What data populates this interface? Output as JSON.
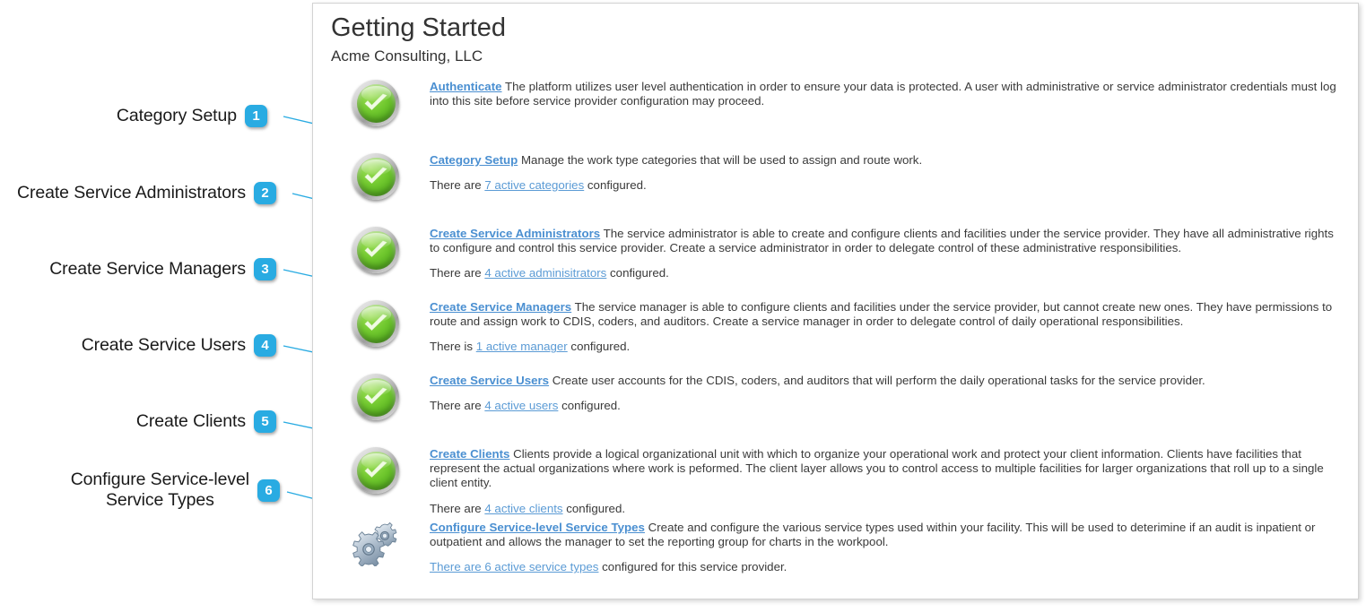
{
  "annotations": [
    {
      "number": "1",
      "label": "Category Setup",
      "multiline": false
    },
    {
      "number": "2",
      "label": "Create Service Administrators",
      "multiline": false
    },
    {
      "number": "3",
      "label": "Create Service Managers",
      "multiline": false
    },
    {
      "number": "4",
      "label": "Create Service Users",
      "multiline": false
    },
    {
      "number": "5",
      "label": "Create Clients",
      "multiline": false
    },
    {
      "number": "6",
      "label": "Configure Service-level\nService Types",
      "multiline": true
    }
  ],
  "panel": {
    "title": "Getting Started",
    "subtitle": "Acme Consulting, LLC",
    "steps": [
      {
        "icon": "green-check-icon",
        "link_label": "Authenticate",
        "description": " The platform utilizes user level authentication in order to ensure your data is protected. A user with administrative or service administrator credentials must log into this site before service provider configuration may proceed.",
        "count_prefix": "",
        "count_link": "",
        "count_suffix": ""
      },
      {
        "icon": "green-check-icon",
        "link_label": "Category Setup",
        "description": " Manage the work type categories that will be used to assign and route work.",
        "count_prefix": "There are ",
        "count_link": "7 active categories",
        "count_suffix": " configured."
      },
      {
        "icon": "green-check-icon",
        "link_label": "Create Service Administrators",
        "description": " The service administrator is able to create and configure clients and facilities under the service provider. They have all administrative rights to configure and control this service provider. Create a service administrator in order to delegate control of these administrative responsibilities.",
        "count_prefix": "There are ",
        "count_link": "4 active adminisitrators",
        "count_suffix": " configured."
      },
      {
        "icon": "green-check-icon",
        "link_label": "Create Service Managers",
        "description": " The service manager is able to configure clients and facilities under the service provider, but cannot create new ones. They have permissions to route and assign work to CDIS, coders, and auditors. Create a service manager in order to delegate control of daily operational responsibilities.",
        "count_prefix": "There is ",
        "count_link": "1 active manager",
        "count_suffix": " configured."
      },
      {
        "icon": "green-check-icon",
        "link_label": "Create Service Users",
        "description": " Create user accounts for the CDIS, coders, and auditors that will perform the daily operational tasks for the service provider.",
        "count_prefix": "There are ",
        "count_link": "4 active users",
        "count_suffix": " configured."
      },
      {
        "icon": "green-check-icon",
        "link_label": "Create Clients",
        "description": " Clients provide a logical organizational unit with which to organize your operational work and protect your client information. Clients have facilities that represent the actual organizations where work is peformed. The client layer allows you to control access to multiple facilities for larger organizations that roll up to a single client entity.",
        "count_prefix": "There are ",
        "count_link": "4 active clients",
        "count_suffix": " configured."
      },
      {
        "icon": "gears-icon",
        "link_label": "Configure Service-level Service Types",
        "description": " Create and configure the various service types used within your facility. This will be used to deterimine if an audit is inpatient or outpatient and allows the manager to set the reporting group for charts in the workpool.",
        "count_prefix": "",
        "count_link": "There are 6 active service types",
        "count_suffix": " configured for this service provider."
      }
    ]
  },
  "colors": {
    "badge": "#29abe2",
    "leader_line": "#29abe2",
    "link": "#4a8fd1",
    "inline_link": "#5b9bd5",
    "text": "#3a3a3a",
    "title": "#333333",
    "panel_border": "#d3d3d3",
    "check_green": "#72c92f"
  }
}
